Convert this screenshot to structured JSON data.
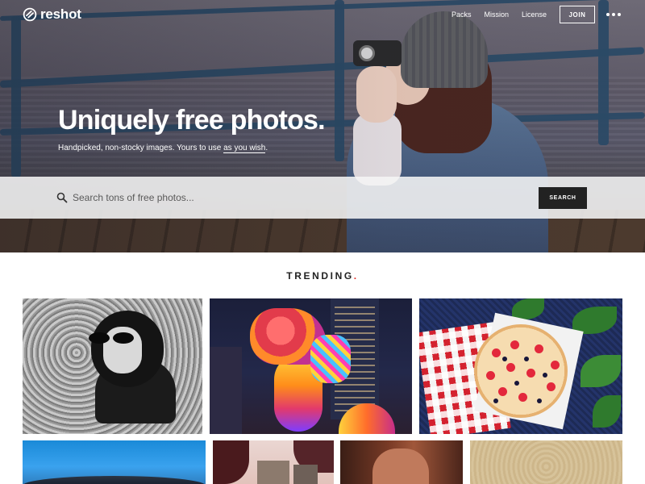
{
  "brand": {
    "logo_text": "reshot",
    "logo_icon": "reshot-logo-icon"
  },
  "nav": {
    "links": [
      "Packs",
      "Mission",
      "License"
    ],
    "join_label": "JOIN",
    "more_icon": "more-dots-icon"
  },
  "hero": {
    "title": "Uniquely free photos.",
    "subtitle_prefix": "Handpicked, non-stocky images. Yours to use ",
    "subtitle_link": "as you wish",
    "subtitle_suffix": "."
  },
  "search": {
    "placeholder": "Search tons of free photos...",
    "value": "",
    "button_label": "SEARCH",
    "icon": "search-icon"
  },
  "trending": {
    "label": "TRENDING",
    "dot": ".",
    "dot_color": "#e0302a"
  },
  "photos": [
    {
      "name": "photo-woman-sunglasses-bw"
    },
    {
      "name": "photo-dragon-lantern"
    },
    {
      "name": "photo-pizza-raspberries"
    },
    {
      "name": "photo-blue-sky-hills"
    },
    {
      "name": "photo-city-trees"
    },
    {
      "name": "photo-portrait-warm"
    },
    {
      "name": "photo-sand-texture"
    }
  ],
  "colors": {
    "accent": "#e0302a",
    "search_button": "#222222",
    "text": "#222222"
  }
}
